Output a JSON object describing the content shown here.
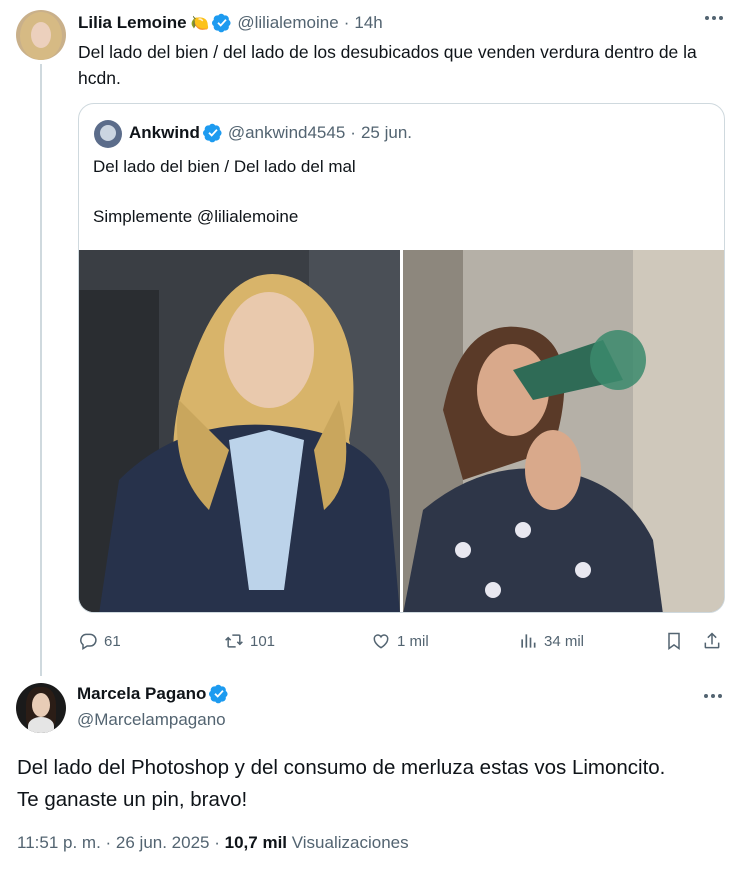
{
  "parent_tweet": {
    "name": "Lilia Lemoine",
    "name_emoji": "🍋",
    "handle": "@lilialemoine",
    "time": "14h",
    "text": "Del lado del bien / del lado de los desubicados que venden verdura dentro de la hcdn.",
    "quote": {
      "name": "Ankwind",
      "handle": "@ankwind4545",
      "date": "25 jun.",
      "text_line1": "Del lado del bien / Del lado del mal",
      "text_line2": "Simplemente @lilialemoine"
    },
    "actions": {
      "replies": "61",
      "reposts": "101",
      "likes": "1 mil",
      "views": "34 mil"
    }
  },
  "main_tweet": {
    "name": "Marcela Pagano",
    "handle": "@Marcelampagano",
    "text_line1": "Del lado del Photoshop y del consumo de merluza estas vos Limoncito.",
    "text_line2": "Te ganaste un pin, bravo!",
    "time": "11:51 p. m.",
    "date": "26 jun. 2025",
    "views_count": "10,7 mil",
    "views_label": "Visualizaciones"
  },
  "colors": {
    "verified": "#1d9bf0",
    "secondary_text": "#536471",
    "border": "#cfd9de"
  },
  "icons": [
    "verified-badge-icon",
    "more-icon",
    "reply-icon",
    "repost-icon",
    "like-icon",
    "views-icon",
    "bookmark-icon",
    "share-icon"
  ]
}
